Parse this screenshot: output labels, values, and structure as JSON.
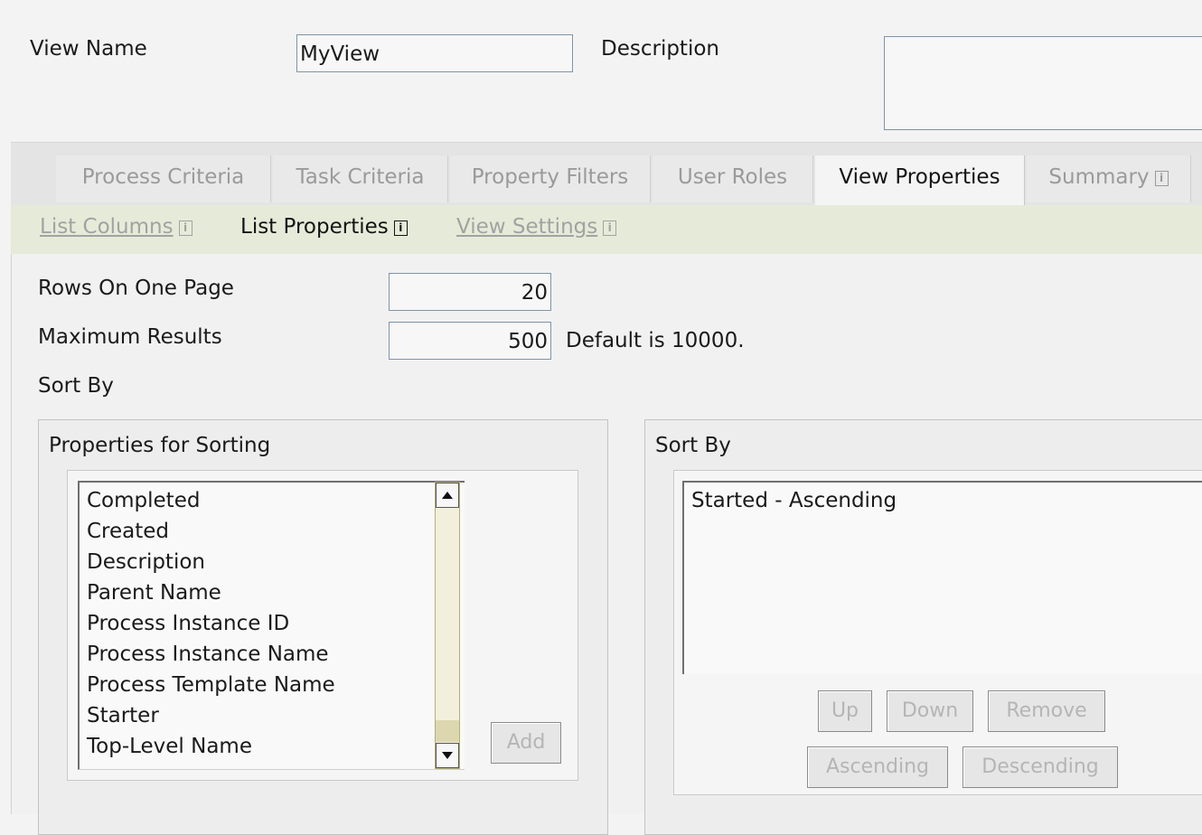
{
  "form": {
    "view_name_label": "View Name",
    "view_name_value": "MyView",
    "description_label": "Description",
    "description_value": ""
  },
  "tabs": [
    {
      "label": "Process Criteria",
      "active": false
    },
    {
      "label": "Task Criteria",
      "active": false
    },
    {
      "label": "Property Filters",
      "active": false
    },
    {
      "label": "User Roles",
      "active": false
    },
    {
      "label": "View Properties",
      "active": true
    },
    {
      "label": "Summary",
      "active": false
    }
  ],
  "subtabs": [
    {
      "label": "List Columns",
      "active": false
    },
    {
      "label": "List Properties",
      "active": true
    },
    {
      "label": "View Settings",
      "active": false
    }
  ],
  "info_glyph": "i",
  "list_properties": {
    "rows_label": "Rows On One Page",
    "rows_value": "20",
    "max_label": "Maximum Results",
    "max_value": "500",
    "max_hint": "Default is 10000.",
    "sort_by_heading": "Sort By"
  },
  "properties_panel": {
    "title": "Properties for Sorting",
    "items": [
      "Completed",
      "Created",
      "Description",
      "Parent Name",
      "Process Instance ID",
      "Process Instance Name",
      "Process Template Name",
      "Starter",
      "Top-Level Name"
    ],
    "add_label": "Add"
  },
  "sort_panel": {
    "title": "Sort By",
    "items": [
      "Started - Ascending"
    ],
    "up_label": "Up",
    "down_label": "Down",
    "remove_label": "Remove",
    "ascending_label": "Ascending",
    "descending_label": "Descending"
  },
  "icons": {
    "scroll_up": "up-arrow-icon",
    "scroll_down": "down-arrow-icon",
    "info": "info-icon"
  }
}
